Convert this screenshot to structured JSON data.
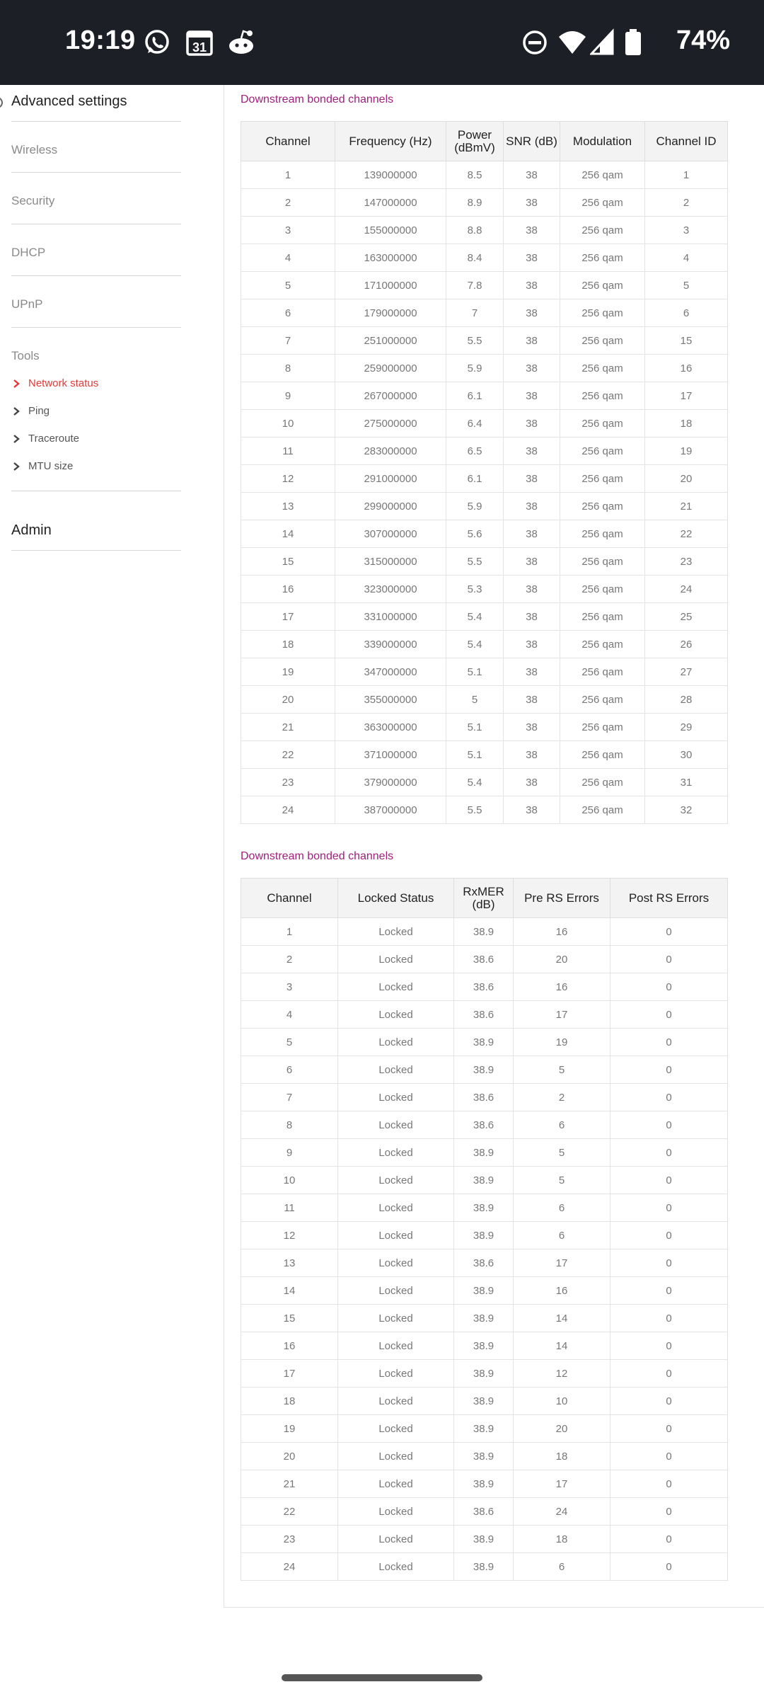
{
  "status_bar": {
    "time": "19:19",
    "calendar_day": "31",
    "battery": "74%"
  },
  "sidebar": {
    "advanced_settings": "Advanced settings",
    "items": [
      "Wireless",
      "Security",
      "DHCP",
      "UPnP"
    ],
    "tools_label": "Tools",
    "tools": [
      {
        "label": "Network status",
        "active": true
      },
      {
        "label": "Ping",
        "active": false
      },
      {
        "label": "Traceroute",
        "active": false
      },
      {
        "label": "MTU size",
        "active": false
      }
    ],
    "admin": "Admin"
  },
  "colors": {
    "accent_title": "#a0207c",
    "active_link": "#e53935",
    "status_bar_bg": "#1c1f26"
  },
  "table1": {
    "title": "Downstream bonded channels",
    "headers": [
      "Channel",
      "Frequency (Hz)",
      "Power (dBmV)",
      "SNR (dB)",
      "Modulation",
      "Channel ID"
    ],
    "rows": [
      [
        "1",
        "139000000",
        "8.5",
        "38",
        "256 qam",
        "1"
      ],
      [
        "2",
        "147000000",
        "8.9",
        "38",
        "256 qam",
        "2"
      ],
      [
        "3",
        "155000000",
        "8.8",
        "38",
        "256 qam",
        "3"
      ],
      [
        "4",
        "163000000",
        "8.4",
        "38",
        "256 qam",
        "4"
      ],
      [
        "5",
        "171000000",
        "7.8",
        "38",
        "256 qam",
        "5"
      ],
      [
        "6",
        "179000000",
        "7",
        "38",
        "256 qam",
        "6"
      ],
      [
        "7",
        "251000000",
        "5.5",
        "38",
        "256 qam",
        "15"
      ],
      [
        "8",
        "259000000",
        "5.9",
        "38",
        "256 qam",
        "16"
      ],
      [
        "9",
        "267000000",
        "6.1",
        "38",
        "256 qam",
        "17"
      ],
      [
        "10",
        "275000000",
        "6.4",
        "38",
        "256 qam",
        "18"
      ],
      [
        "11",
        "283000000",
        "6.5",
        "38",
        "256 qam",
        "19"
      ],
      [
        "12",
        "291000000",
        "6.1",
        "38",
        "256 qam",
        "20"
      ],
      [
        "13",
        "299000000",
        "5.9",
        "38",
        "256 qam",
        "21"
      ],
      [
        "14",
        "307000000",
        "5.6",
        "38",
        "256 qam",
        "22"
      ],
      [
        "15",
        "315000000",
        "5.5",
        "38",
        "256 qam",
        "23"
      ],
      [
        "16",
        "323000000",
        "5.3",
        "38",
        "256 qam",
        "24"
      ],
      [
        "17",
        "331000000",
        "5.4",
        "38",
        "256 qam",
        "25"
      ],
      [
        "18",
        "339000000",
        "5.4",
        "38",
        "256 qam",
        "26"
      ],
      [
        "19",
        "347000000",
        "5.1",
        "38",
        "256 qam",
        "27"
      ],
      [
        "20",
        "355000000",
        "5",
        "38",
        "256 qam",
        "28"
      ],
      [
        "21",
        "363000000",
        "5.1",
        "38",
        "256 qam",
        "29"
      ],
      [
        "22",
        "371000000",
        "5.1",
        "38",
        "256 qam",
        "30"
      ],
      [
        "23",
        "379000000",
        "5.4",
        "38",
        "256 qam",
        "31"
      ],
      [
        "24",
        "387000000",
        "5.5",
        "38",
        "256 qam",
        "32"
      ]
    ]
  },
  "table2": {
    "title": "Downstream bonded channels",
    "headers": [
      "Channel",
      "Locked Status",
      "RxMER (dB)",
      "Pre RS Errors",
      "Post RS Errors"
    ],
    "rows": [
      [
        "1",
        "Locked",
        "38.9",
        "16",
        "0"
      ],
      [
        "2",
        "Locked",
        "38.6",
        "20",
        "0"
      ],
      [
        "3",
        "Locked",
        "38.6",
        "16",
        "0"
      ],
      [
        "4",
        "Locked",
        "38.6",
        "17",
        "0"
      ],
      [
        "5",
        "Locked",
        "38.9",
        "19",
        "0"
      ],
      [
        "6",
        "Locked",
        "38.9",
        "5",
        "0"
      ],
      [
        "7",
        "Locked",
        "38.6",
        "2",
        "0"
      ],
      [
        "8",
        "Locked",
        "38.6",
        "6",
        "0"
      ],
      [
        "9",
        "Locked",
        "38.9",
        "5",
        "0"
      ],
      [
        "10",
        "Locked",
        "38.9",
        "5",
        "0"
      ],
      [
        "11",
        "Locked",
        "38.9",
        "6",
        "0"
      ],
      [
        "12",
        "Locked",
        "38.9",
        "6",
        "0"
      ],
      [
        "13",
        "Locked",
        "38.6",
        "17",
        "0"
      ],
      [
        "14",
        "Locked",
        "38.9",
        "16",
        "0"
      ],
      [
        "15",
        "Locked",
        "38.9",
        "14",
        "0"
      ],
      [
        "16",
        "Locked",
        "38.9",
        "14",
        "0"
      ],
      [
        "17",
        "Locked",
        "38.9",
        "12",
        "0"
      ],
      [
        "18",
        "Locked",
        "38.9",
        "10",
        "0"
      ],
      [
        "19",
        "Locked",
        "38.9",
        "20",
        "0"
      ],
      [
        "20",
        "Locked",
        "38.9",
        "18",
        "0"
      ],
      [
        "21",
        "Locked",
        "38.9",
        "17",
        "0"
      ],
      [
        "22",
        "Locked",
        "38.6",
        "24",
        "0"
      ],
      [
        "23",
        "Locked",
        "38.9",
        "18",
        "0"
      ],
      [
        "24",
        "Locked",
        "38.9",
        "6",
        "0"
      ]
    ]
  }
}
